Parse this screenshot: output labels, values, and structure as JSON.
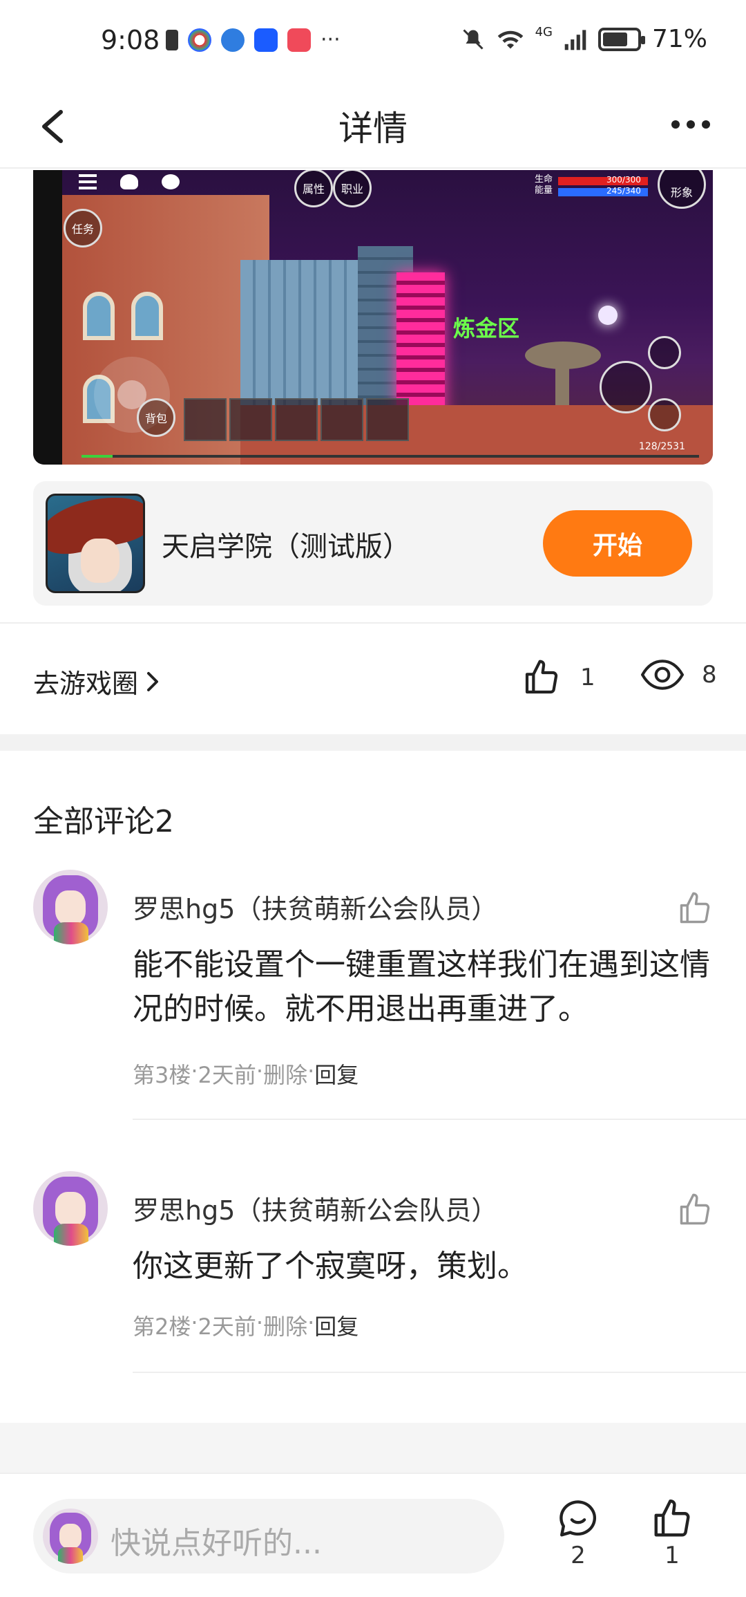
{
  "status_bar": {
    "time": "9:08",
    "battery": "71%",
    "battery_level": 0.71,
    "network": "4G",
    "left_icons": [
      "battery-saver-icon",
      "app-icon-1",
      "app-icon-2",
      "app-icon-3",
      "app-icon-4",
      "more-dots-icon"
    ],
    "right_icons": [
      "mute-icon",
      "wifi-icon",
      "signal-icon",
      "battery-icon"
    ],
    "more": "···"
  },
  "nav": {
    "title": "详情",
    "back_icon": "back-arrow-icon",
    "more_icon": "more-icon"
  },
  "game_screenshot": {
    "zone_label": "炼金区",
    "hud": {
      "task": "任务",
      "bag": "背包",
      "attribute": "属性",
      "career": "职业",
      "appearance": "形象",
      "hp_label": "生命",
      "mp_label": "能量",
      "hp_value": "300/300",
      "mp_value": "245/340",
      "exp_value": "128/2531",
      "exp_fraction": 0.05
    }
  },
  "game_card": {
    "name": "天启学院（测试版）",
    "start_label": "开始"
  },
  "circle_row": {
    "goto_label": "去游戏圈",
    "likes": "1",
    "views": "8"
  },
  "comments": {
    "title": "全部评论2",
    "items": [
      {
        "author": "罗思hg5（扶贫萌新公会队员）",
        "text": "能不能设置个一键重置这样我们在遇到这情况的时候。就不用退出再重进了。",
        "floor": "第3楼",
        "time": "2天前",
        "delete": "删除",
        "reply": "回复",
        "sep": " · "
      },
      {
        "author": "罗思hg5（扶贫萌新公会队员）",
        "text": "你这更新了个寂寞呀，策划。",
        "floor": "第2楼",
        "time": "2天前",
        "delete": "删除",
        "reply": "回复",
        "sep": " · "
      }
    ]
  },
  "bottom_bar": {
    "placeholder": "快说点好听的...",
    "comment_count": "2",
    "like_count": "1"
  },
  "colors": {
    "accent": "#ff7a12",
    "text": "#222222",
    "muted": "#999999"
  }
}
